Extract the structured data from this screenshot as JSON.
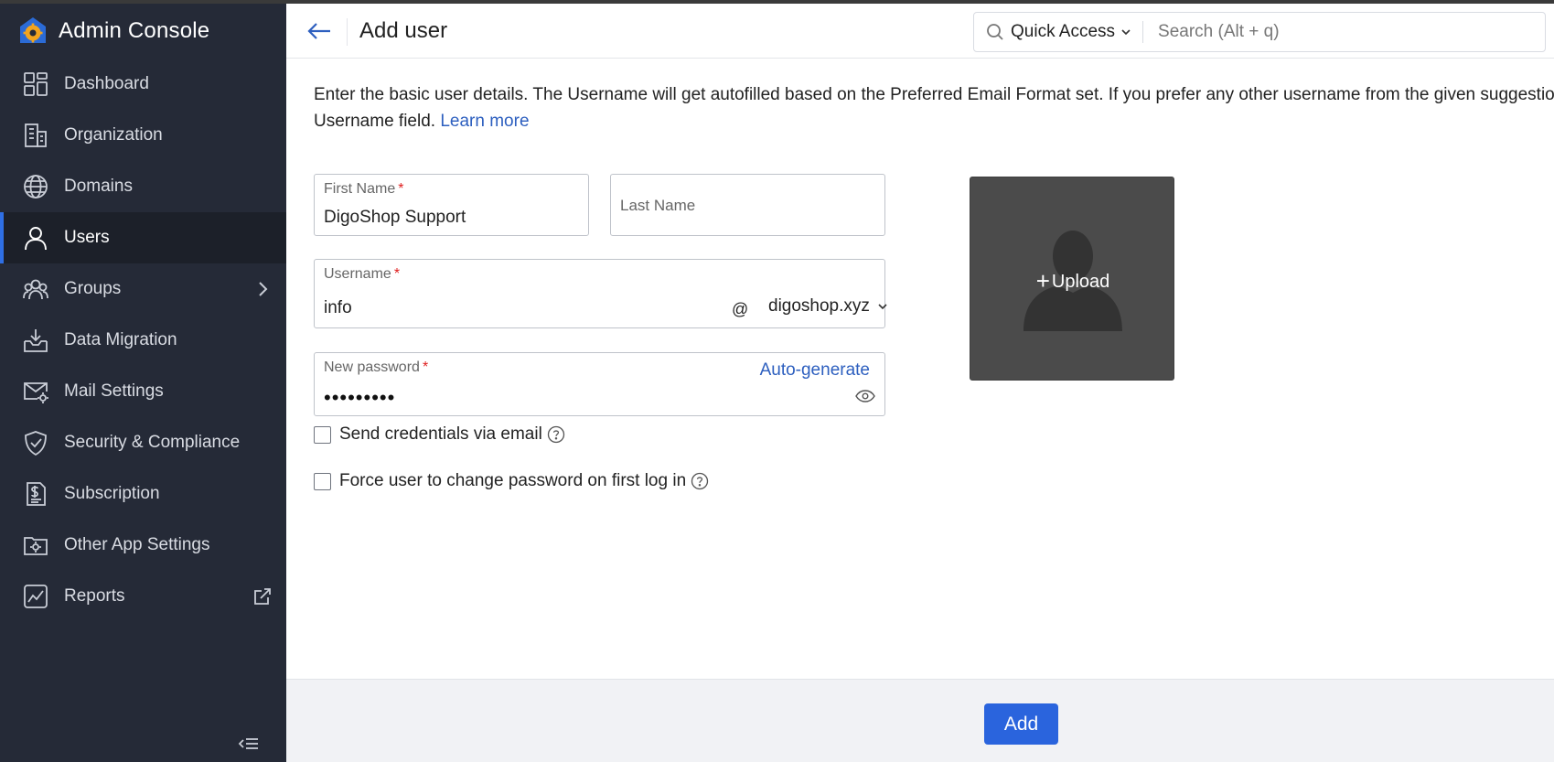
{
  "app": {
    "title": "Admin Console"
  },
  "sidebar": {
    "items": [
      {
        "label": "Dashboard",
        "icon": "dashboard-icon"
      },
      {
        "label": "Organization",
        "icon": "building-icon"
      },
      {
        "label": "Domains",
        "icon": "globe-icon"
      },
      {
        "label": "Users",
        "icon": "user-icon",
        "active": true
      },
      {
        "label": "Groups",
        "icon": "group-icon",
        "trailing": "chevron-right-icon"
      },
      {
        "label": "Data Migration",
        "icon": "download-tray-icon"
      },
      {
        "label": "Mail Settings",
        "icon": "mail-gear-icon"
      },
      {
        "label": "Security & Compliance",
        "icon": "shield-check-icon"
      },
      {
        "label": "Subscription",
        "icon": "invoice-dollar-icon"
      },
      {
        "label": "Other App Settings",
        "icon": "folder-gear-icon"
      },
      {
        "label": "Reports",
        "icon": "chart-line-icon",
        "trailing": "external-link-icon"
      }
    ]
  },
  "header": {
    "title": "Add user",
    "quick_access": "Quick Access",
    "search_placeholder": "Search (Alt + q)"
  },
  "form": {
    "intro": "Enter the basic user details. The Username will get autofilled based on the Preferred Email Format set. If you prefer any other username from the given suggestions,",
    "intro_line2": "Username field.",
    "learn_more": "Learn more",
    "first_name_label": "First Name",
    "first_name_value": "DigoShop Support",
    "last_name_label": "Last Name",
    "last_name_value": "",
    "username_label": "Username",
    "username_value": "info",
    "at_sign": "@",
    "domain": "digoshop.xyz",
    "password_label": "New password",
    "password_masked": "•••••••••",
    "auto_generate": "Auto-generate",
    "required_mark": "*",
    "send_credentials": "Send credentials via email",
    "force_change": "Force user to change password on first log in",
    "upload": "Upload",
    "upload_plus": "+"
  },
  "footer": {
    "add_label": "Add"
  },
  "colors": {
    "sidebar_bg": "#252a37",
    "accent": "#2a64dd",
    "link": "#2d5fbf",
    "required": "#e02020"
  }
}
